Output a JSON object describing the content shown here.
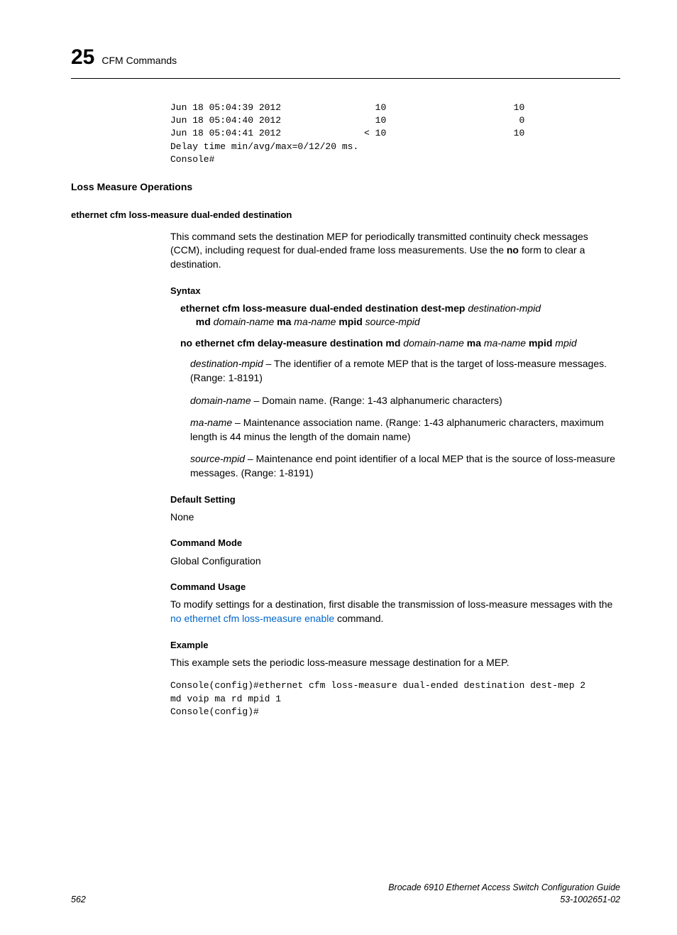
{
  "header": {
    "chapter_num": "25",
    "chapter_title": "CFM Commands"
  },
  "code_block1": "Jun 18 05:04:39 2012                 10                       10\nJun 18 05:04:40 2012                 10                        0\nJun 18 05:04:41 2012               < 10                       10\nDelay time min/avg/max=0/12/20 ms.\nConsole#",
  "h2_loss": "Loss Measure Operations",
  "h3_cmd": "ethernet cfm loss-measure dual-ended destination",
  "intro_p1": "This command sets the destination MEP for periodically transmitted continuity check messages (CCM), including request for dual-ended frame loss measurements. Use the ",
  "intro_no": "no",
  "intro_p2": " form to clear a destination.",
  "syntax_h": "Syntax",
  "syntax1": {
    "b1": "ethernet cfm loss-measure dual-ended destination dest-mep ",
    "i1": "destination-mpid",
    "b2": "md ",
    "i2": "domain-name",
    "b3": " ma ",
    "i3": "ma-name",
    "b4": " mpid ",
    "i4": "source-mpid"
  },
  "syntax2": {
    "b1": "no ethernet cfm delay-measure destination md ",
    "i1": "domain-name",
    "b2": " ma ",
    "i2": "ma-name",
    "b3": " mpid ",
    "i3": "mpid"
  },
  "params": {
    "p1_i": "destination-mpid",
    "p1_t": " – The identifier of a remote MEP that is the target of loss-measure messages. (Range: 1-8191)",
    "p2_i": "domain-name",
    "p2_t": " – Domain name. (Range: 1-43 alphanumeric characters)",
    "p3_i": "ma-name",
    "p3_t": " – Maintenance association name. (Range: 1-43 alphanumeric characters, maximum length is 44 minus the length of the domain name)",
    "p4_i": "source-mpid",
    "p4_t": " – Maintenance end point identifier of a local MEP that is the source of loss-measure messages. (Range: 1-8191)"
  },
  "default_h": "Default Setting",
  "default_v": "None",
  "mode_h": "Command Mode",
  "mode_v": "Global Configuration",
  "usage_h": "Command Usage",
  "usage_p1": "To modify settings for a destination, first disable the transmission of loss-measure messages with the ",
  "usage_link": "no ethernet cfm loss-measure enable",
  "usage_p2": " command.",
  "example_h": "Example",
  "example_p": "This example sets the periodic loss-measure message destination for a MEP.",
  "code_block2": "Console(config)#ethernet cfm loss-measure dual-ended destination dest-mep 2 \nmd voip ma rd mpid 1\nConsole(config)#",
  "footer": {
    "page": "562",
    "title": "Brocade 6910 Ethernet Access Switch Configuration Guide",
    "docnum": "53-1002651-02"
  }
}
